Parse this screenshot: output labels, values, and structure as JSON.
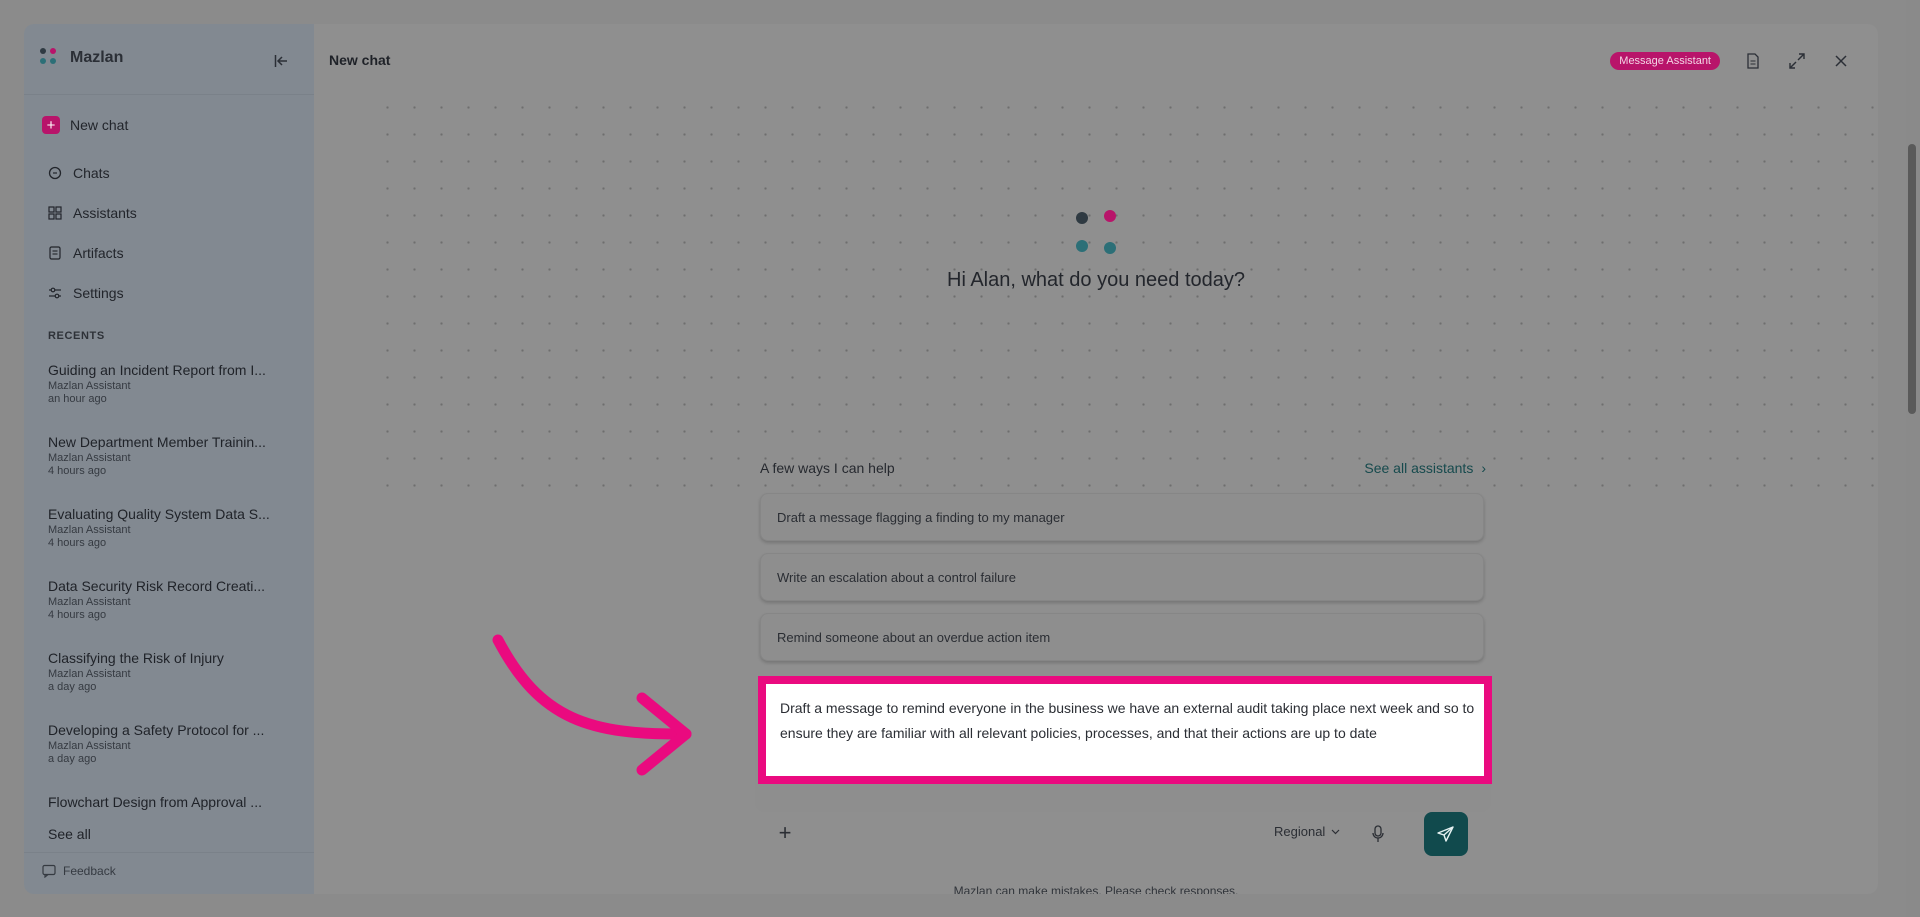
{
  "sidebar": {
    "brand": "Mazlan",
    "new_chat": "New chat",
    "nav": [
      {
        "label": "Chats",
        "icon": "chat-icon"
      },
      {
        "label": "Assistants",
        "icon": "grid-icon"
      },
      {
        "label": "Artifacts",
        "icon": "document-icon"
      },
      {
        "label": "Settings",
        "icon": "sliders-icon"
      }
    ],
    "recents_heading": "RECENTS",
    "recents": [
      {
        "title": "Guiding an Incident Report from I...",
        "assistant": "Mazlan Assistant",
        "time": "an hour ago"
      },
      {
        "title": "New Department Member Trainin...",
        "assistant": "Mazlan Assistant",
        "time": "4 hours ago"
      },
      {
        "title": "Evaluating Quality System Data S...",
        "assistant": "Mazlan Assistant",
        "time": "4 hours ago"
      },
      {
        "title": "Data Security Risk Record Creati...",
        "assistant": "Mazlan Assistant",
        "time": "4 hours ago"
      },
      {
        "title": "Classifying the Risk of Injury",
        "assistant": "Mazlan Assistant",
        "time": "a day ago"
      },
      {
        "title": "Developing a Safety Protocol for ...",
        "assistant": "Mazlan Assistant",
        "time": "a day ago"
      },
      {
        "title": "Flowchart Design from Approval ...",
        "assistant": "",
        "time": ""
      }
    ],
    "see_all": "See all",
    "feedback": "Feedback"
  },
  "header": {
    "title": "New chat",
    "badge": "Message Assistant"
  },
  "hero": {
    "greeting": "Hi Alan, what do you need today?"
  },
  "helper": {
    "label": "A few ways I can help",
    "link": "See all assistants",
    "suggestions": [
      "Draft a message flagging a finding to my manager",
      "Write an escalation about a control failure",
      "Remind someone about an overdue action item"
    ]
  },
  "composer": {
    "value": "Draft a message to remind everyone in the business we have an external audit taking place next week and so to ensure they are familiar with all relevant policies, processes, and that their actions are up to date",
    "region": "Regional"
  },
  "disclaimer": "Mazlan can make mistakes. Please check responses.",
  "colors": {
    "accent": "#b8146a",
    "highlight": "#ea0a7f",
    "send": "#114a4d"
  }
}
